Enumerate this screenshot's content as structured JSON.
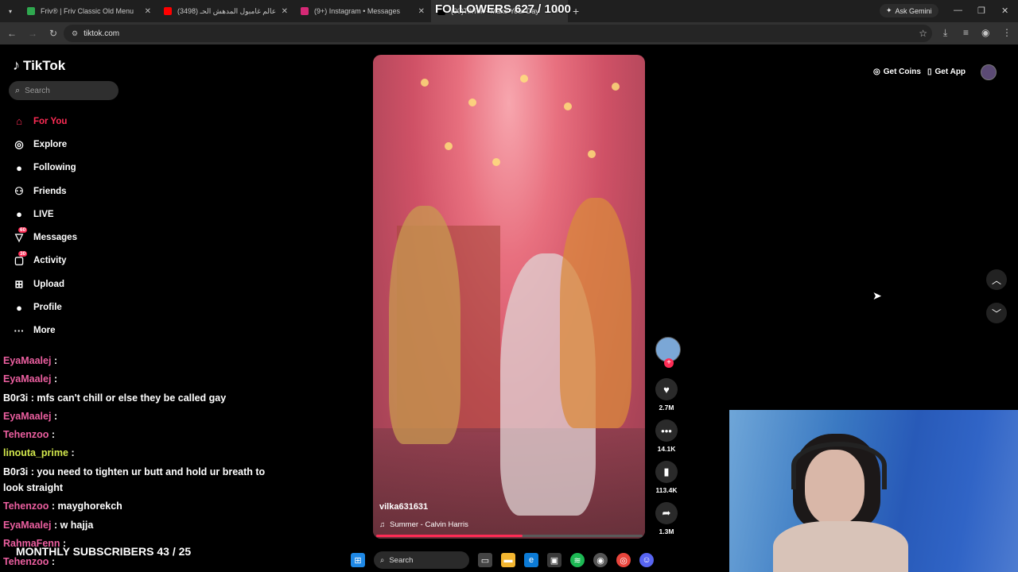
{
  "browser": {
    "tabs": [
      {
        "label": "Friv® | Friv Classic Old Menu",
        "favicon_color": "#2fa84f",
        "active": false
      },
      {
        "label": "(3498) عالم غامبول المدهش الحـ",
        "favicon_color": "#ff0000",
        "active": false
      },
      {
        "label": "(9+) Instagram • Messages",
        "favicon_color": "#d62976",
        "active": false
      },
      {
        "label": "(90)TikTok - Make Your Day",
        "favicon_color": "#000000",
        "active": true
      }
    ],
    "ask_gemini": "Ask Gemini",
    "url": "tiktok.com"
  },
  "overlay": {
    "followers": "FOLLOWERS 627 / 1000",
    "monthly": "MONTHLY SUBSCRIBERS 43 / 25"
  },
  "tiktok": {
    "logo": "TikTok",
    "search_placeholder": "Search",
    "menu": [
      {
        "label": "For You",
        "icon": "home-icon",
        "glyph": "⌂",
        "active": true,
        "badge": ""
      },
      {
        "label": "Explore",
        "icon": "compass-icon",
        "glyph": "◎",
        "active": false,
        "badge": ""
      },
      {
        "label": "Following",
        "icon": "following-icon",
        "glyph": "●",
        "active": false,
        "badge": ""
      },
      {
        "label": "Friends",
        "icon": "friends-icon",
        "glyph": "⚇",
        "active": false,
        "badge": ""
      },
      {
        "label": "LIVE",
        "icon": "live-icon",
        "glyph": "●",
        "active": false,
        "badge": ""
      },
      {
        "label": "Messages",
        "icon": "messages-icon",
        "glyph": "▽",
        "active": false,
        "badge": "60"
      },
      {
        "label": "Activity",
        "icon": "activity-icon",
        "glyph": "▢",
        "active": false,
        "badge": "30"
      },
      {
        "label": "Upload",
        "icon": "upload-icon",
        "glyph": "⊞",
        "active": false,
        "badge": ""
      },
      {
        "label": "Profile",
        "icon": "profile-icon",
        "glyph": "●",
        "active": false,
        "badge": ""
      },
      {
        "label": "More",
        "icon": "more-icon",
        "glyph": "···",
        "active": false,
        "badge": ""
      }
    ],
    "get_coins": "Get Coins",
    "get_app": "Get App",
    "video": {
      "username": "vilka631631",
      "music": "Summer - Calvin Harris",
      "progress": 0.55
    },
    "actions": [
      {
        "name": "like",
        "icon": "heart-icon",
        "glyph": "♥",
        "count": "2.7M"
      },
      {
        "name": "comment",
        "icon": "comment-icon",
        "glyph": "•••",
        "count": "14.1K"
      },
      {
        "name": "save",
        "icon": "bookmark-icon",
        "glyph": "▮",
        "count": "113.4K"
      },
      {
        "name": "share",
        "icon": "share-icon",
        "glyph": "➦",
        "count": "1.3M"
      }
    ]
  },
  "chat": [
    {
      "user": "EyaMaalej",
      "text": ":",
      "color": "pink"
    },
    {
      "user": "EyaMaalej",
      "text": ":",
      "color": "pink"
    },
    {
      "user": "B0r3i",
      "text": ": mfs can't chill or else they be called gay",
      "color": "white"
    },
    {
      "user": "EyaMaalej",
      "text": ":",
      "color": "pink"
    },
    {
      "user": "Tehenzoo",
      "text": ":",
      "color": "pink"
    },
    {
      "user": "linouta_prime",
      "text": ":",
      "color": "yellow"
    },
    {
      "user": "B0r3i",
      "text": ": you need to tighten ur butt and hold ur breath to",
      "color": "white"
    },
    {
      "user": "",
      "text": "look straight",
      "color": "white"
    },
    {
      "user": "Tehenzoo",
      "text": ": mayghorekch",
      "color": "pink"
    },
    {
      "user": "EyaMaalej",
      "text": ": w hajja",
      "color": "pink"
    },
    {
      "user": "RahmaFenn",
      "text": ":",
      "color": "pink"
    },
    {
      "user": "Tehenzoo",
      "text": ":",
      "color": "pink"
    }
  ],
  "taskbar": {
    "search": "Search"
  }
}
